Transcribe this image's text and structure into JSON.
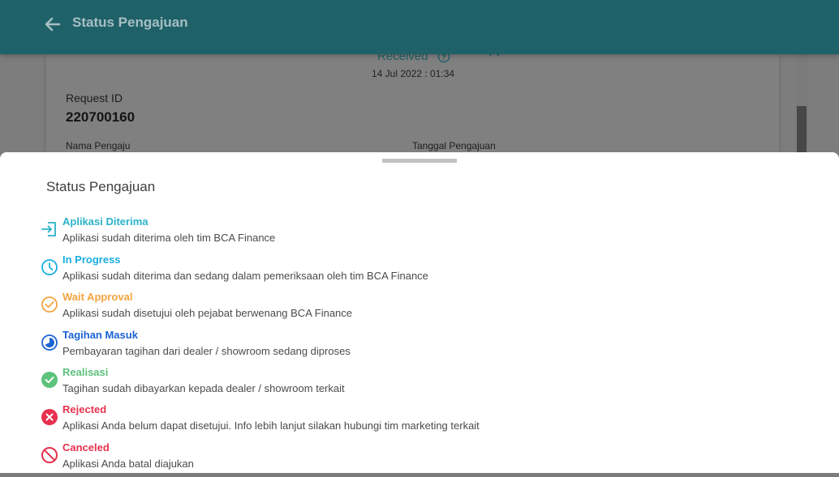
{
  "header": {
    "title": "Status Pengajuan",
    "back_icon": "arrow-left-icon"
  },
  "detail": {
    "status": "Received",
    "date": "14 Jul 2022 : 01:34",
    "request_id_label": "Request ID",
    "request_id": "220700160",
    "nama_label": "Nama Pengaju",
    "tanggal_label": "Tanggal Pengajuan"
  },
  "sheet": {
    "title": "Status Pengajuan",
    "items": [
      {
        "name": "Aplikasi Diterima",
        "desc": "Aplikasi sudah diterima oleh tim BCA Finance",
        "color": "#2ab3c8",
        "icon": "login-icon"
      },
      {
        "name": "In Progress",
        "desc": "Aplikasi sudah diterima dan sedang dalam pemeriksaan oleh tim BCA Finance",
        "color": "#19aee0",
        "icon": "clock-icon"
      },
      {
        "name": "Wait Approval",
        "desc": "Aplikasi sudah disetujui oleh pejabat berwenang BCA Finance",
        "color": "#f3a43f",
        "icon": "check-circle-outline-icon"
      },
      {
        "name": "Tagihan Masuk",
        "desc": "Pembayaran tagihan dari dealer / showroom sedang diproses",
        "color": "#1b63d3",
        "icon": "pie-circle-icon"
      },
      {
        "name": "Realisasi",
        "desc": "Tagihan sudah dibayarkan kepada dealer / showroom terkait",
        "color": "#5cc27c",
        "icon": "check-circle-filled-icon"
      },
      {
        "name": "Rejected",
        "desc": "Aplikasi Anda belum dapat disetujui. Info lebih lanjut silakan hubungi tim marketing terkait",
        "color": "#e8314e",
        "icon": "x-circle-filled-icon"
      },
      {
        "name": "Canceled",
        "desc": "Aplikasi Anda batal diajukan",
        "color": "#e8314e",
        "icon": "block-icon"
      }
    ]
  }
}
